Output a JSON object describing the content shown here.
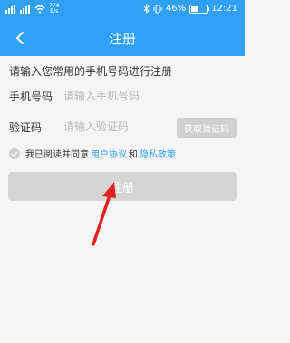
{
  "statusbar": {
    "speed_value": "774",
    "speed_unit": "B/s",
    "battery": "46%",
    "battery_level": 0.46,
    "time": "12:21"
  },
  "header": {
    "title": "注册"
  },
  "form": {
    "hint": "请输入您常用的手机号码进行注册",
    "phone_label": "手机号码",
    "phone_placeholder": "请输入手机号码",
    "code_label": "验证码",
    "code_placeholder": "请输入验证码",
    "get_code_label": "获取验证码",
    "agree_prefix": "我已阅读并同意",
    "user_agreement": "用户协议",
    "and": "和",
    "privacy_policy": "隐私政策",
    "register_label": "注册"
  },
  "colors": {
    "accent": "#2fa0f4",
    "disabled_button": "#d5d5d5",
    "annotation_arrow": "#e02020"
  }
}
